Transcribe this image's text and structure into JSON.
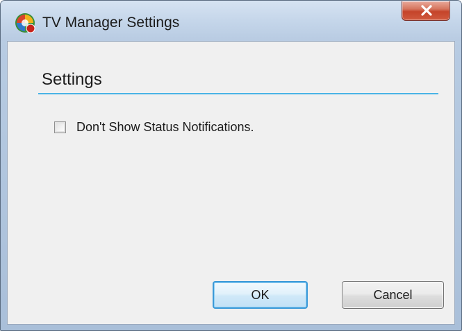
{
  "window": {
    "title": "TV Manager Settings",
    "close_glyph": "x",
    "app_icon": "windows-media-center-icon",
    "close_icon": "close-icon"
  },
  "settings": {
    "section_title": "Settings",
    "checkbox_label": "Don't Show Status Notifications.",
    "checkbox_checked": false
  },
  "buttons": {
    "ok_label": "OK",
    "cancel_label": "Cancel"
  },
  "colors": {
    "accent_rule": "#49b4e6",
    "close_button": "#c5442a",
    "default_button_border": "#3c9ad8"
  }
}
